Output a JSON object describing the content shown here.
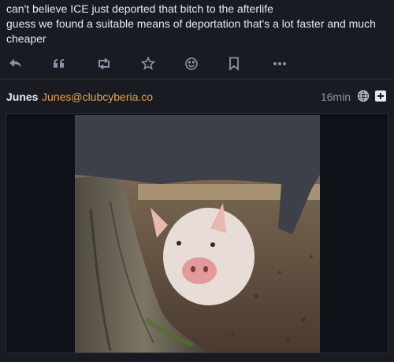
{
  "post": {
    "lines": [
      "can't believe ICE just deported that bitch to the afterlife",
      "guess we found a suitable means of deportation that's a lot faster and much cheaper"
    ]
  },
  "actions": [
    "reply-icon",
    "quote-icon",
    "boost-icon",
    "favourite-icon",
    "emoji-reaction-icon",
    "bookmark-icon",
    "more-icon"
  ],
  "reply": {
    "author": "Junes",
    "handle": "Junes@clubcyberia.co",
    "time": "16min",
    "visibility_icon": "globe-icon",
    "expand_icon": "plus-square-icon"
  },
  "colors": {
    "background": "#191b22",
    "handle": "#e8a24d",
    "muted": "#8a93a8"
  }
}
